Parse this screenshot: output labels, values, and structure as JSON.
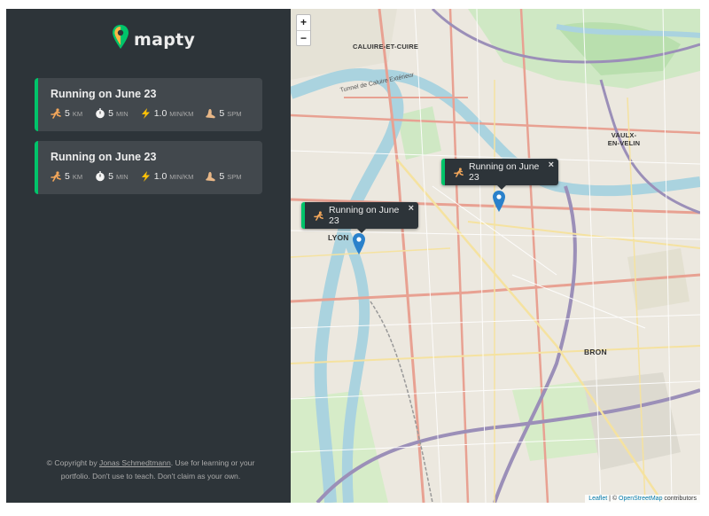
{
  "logo": {
    "text": "mapty"
  },
  "workouts": [
    {
      "title": "Running on June 23",
      "distance": {
        "value": "5",
        "unit": "km"
      },
      "duration": {
        "value": "5",
        "unit": "min"
      },
      "pace": {
        "value": "1.0",
        "unit": "min/km"
      },
      "cadence": {
        "value": "5",
        "unit": "spm"
      }
    },
    {
      "title": "Running on June 23",
      "distance": {
        "value": "5",
        "unit": "km"
      },
      "duration": {
        "value": "5",
        "unit": "min"
      },
      "pace": {
        "value": "1.0",
        "unit": "min/km"
      },
      "cadence": {
        "value": "5",
        "unit": "spm"
      }
    }
  ],
  "copyright": {
    "prefix": "© Copyright by ",
    "author": "Jonas Schmedtmann",
    "suffix": ". Use for learning or your portfolio. Don't use to teach. Don't claim as your own."
  },
  "map": {
    "zoom_in": "+",
    "zoom_out": "−",
    "popups": [
      {
        "text": "Running on June 23",
        "close": "×"
      },
      {
        "text": "Running on June 23",
        "close": "×"
      }
    ],
    "places": {
      "caluire": "CALUIRE-ET-CUIRE",
      "lyon": "LYON",
      "vaulx": "VAULX-EN-VELIN",
      "bron": "BRON",
      "tunnel": "Tunnel de Caluire Extérieur"
    },
    "attribution": {
      "leaflet": "Leaflet",
      "separator": " | © ",
      "osm": "OpenStreetMap",
      "suffix": " contributors"
    }
  },
  "colors": {
    "sidebar": "#2d3439",
    "card": "#42484d",
    "accent": "#00c46a",
    "marker": "#2a81cb"
  }
}
